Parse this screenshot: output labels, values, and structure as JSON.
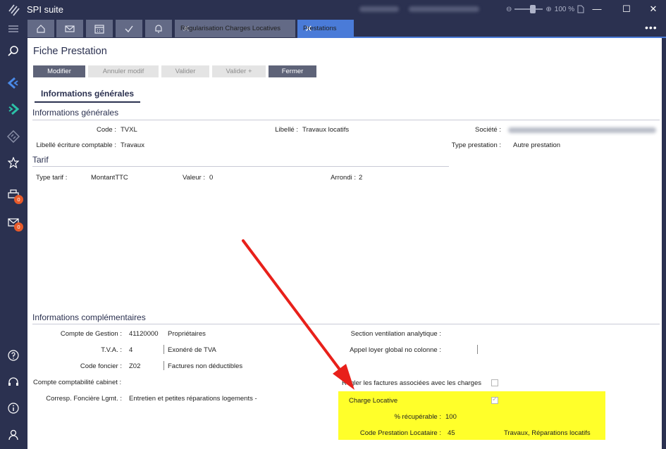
{
  "app": {
    "title": "SPI suite",
    "zoom": "100 %",
    "minimize": "—",
    "maximize": "☐",
    "close": "✕",
    "more": "•••"
  },
  "tabs": {
    "regularisation": "Régularisation Charges Locatives",
    "prestations": "Prestations",
    "close_glyph": "✕"
  },
  "sidebar": {
    "print_badge": "0",
    "mail_badge": "0"
  },
  "page": {
    "title": "Fiche Prestation",
    "buttons": {
      "modifier": "Modifier",
      "annuler": "Annuler modif",
      "valider": "Valider",
      "valider_plus": "Valider +",
      "fermer": "Fermer"
    },
    "tab_label": "Informations générales"
  },
  "infos_generales": {
    "title": "Informations générales",
    "code_label": "Code :",
    "code_value": "TVXL",
    "libelle_label": "Libellé :",
    "libelle_value": "Travaux locatifs",
    "societe_label": "Société :",
    "libelle_ecriture_label": "Libellé écriture comptable :",
    "libelle_ecriture_value": "Travaux",
    "type_prestation_label": "Type prestation :",
    "type_prestation_value": "Autre prestation"
  },
  "tarif": {
    "title": "Tarif",
    "type_label": "Type tarif :",
    "type_value": "MontantTTC",
    "valeur_label": "Valeur :",
    "valeur_value": "0",
    "arrondi_label": "Arrondi :",
    "arrondi_value": "2"
  },
  "infos_complementaires": {
    "title": "Informations complémentaires",
    "compte_gestion_label": "Compte de Gestion :",
    "compte_gestion_code": "41120000",
    "compte_gestion_value": "Propriétaires",
    "tva_label": "T.V.A. :",
    "tva_code": "4",
    "tva_value": "Exonéré de TVA",
    "code_foncier_label": "Code foncier :",
    "code_foncier_code": "Z02",
    "code_foncier_value": "Factures non déductibles",
    "compte_cabinet_label": "Compte comptabilité cabinet :",
    "corresp_label": "Corresp. Foncière Lgmt. :",
    "corresp_value": "Entretien et petites réparations logements -",
    "section_ventilation_label": "Section ventilation analytique :",
    "appel_loyer_label": "Appel loyer global no colonne :",
    "regler_label": "Régler les factures associées avec les charges",
    "charge_locative_label": "Charge Locative",
    "recuperable_label": "% récupérable :",
    "recuperable_value": "100",
    "code_prestation_label": "Code Prestation Locataire :",
    "code_prestation_code": "45",
    "code_prestation_value": "Travaux, Réparations locatifs"
  },
  "colors": {
    "chrome": "#2b3150",
    "tab_active": "#4a7bd8",
    "highlight": "#ffff2a",
    "arrow": "#e8201a",
    "badge": "#e85a2a"
  }
}
